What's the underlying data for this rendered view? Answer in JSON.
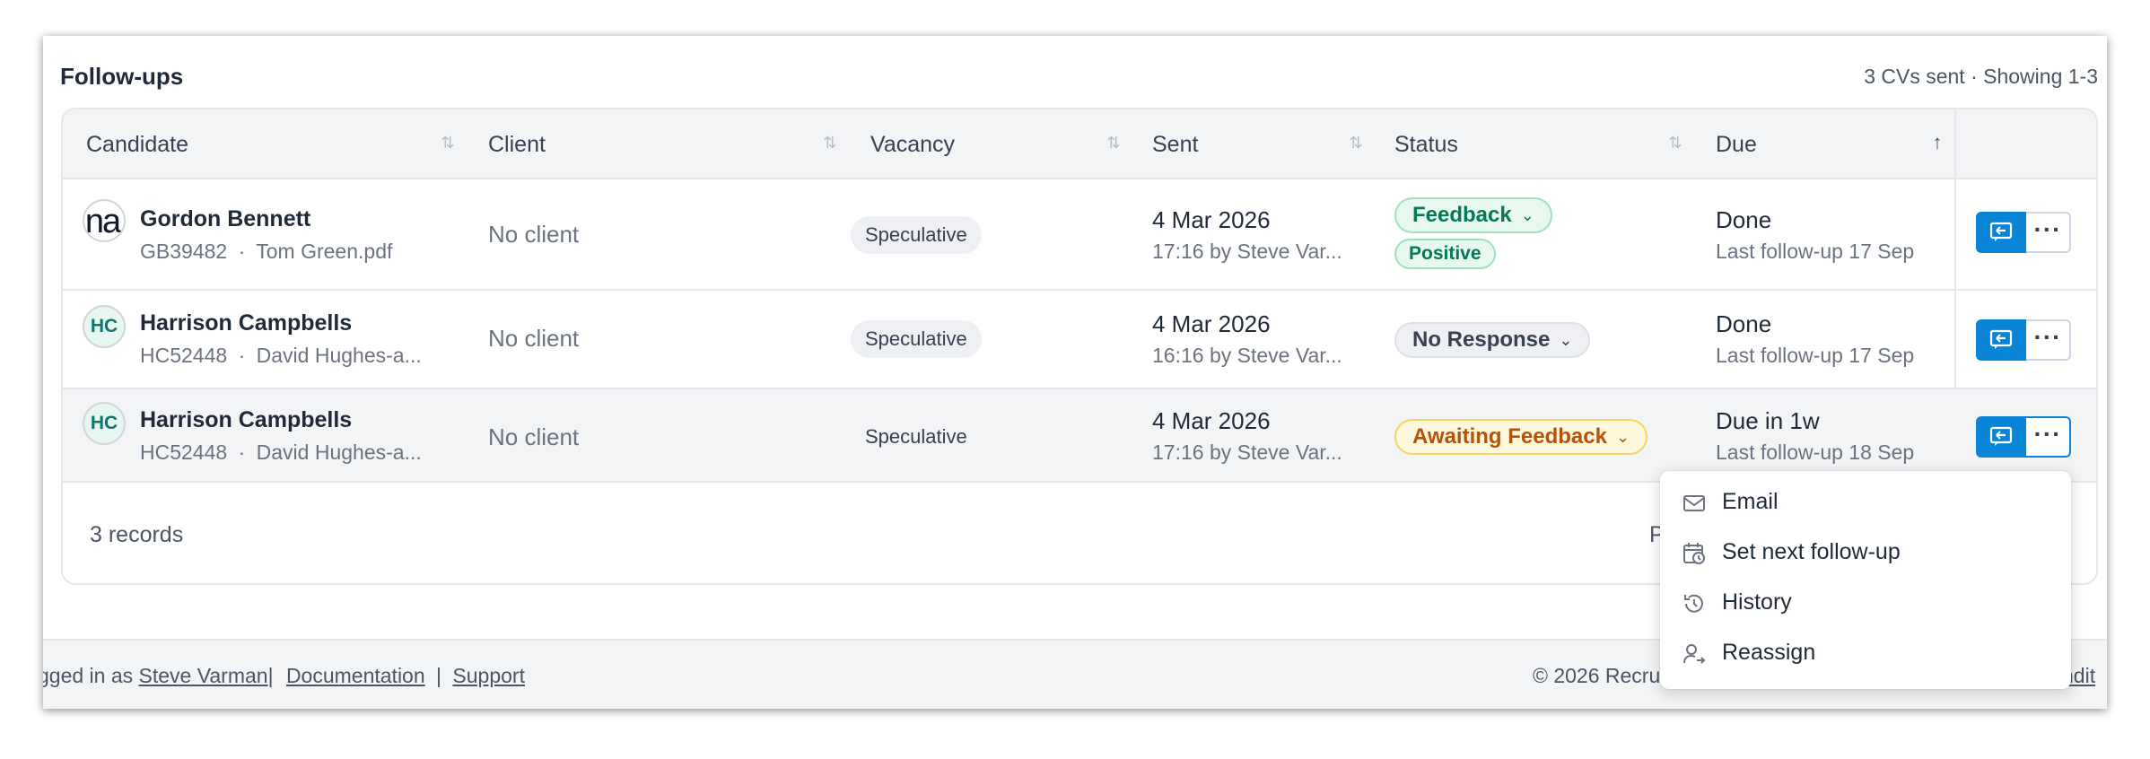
{
  "panel": {
    "title": "Follow-ups",
    "meta": "3 CVs sent · Showing 1-3"
  },
  "columns": {
    "candidate": "Candidate",
    "client": "Client",
    "vacancy": "Vacancy",
    "sent": "Sent",
    "status": "Status",
    "due": "Due"
  },
  "rows": [
    {
      "avatar": "na",
      "name": "Gordon Bennett",
      "ref": "GB39482",
      "doc": "Tom Green.pdf",
      "client": "No client",
      "vacancy": "Speculative",
      "sent_date": "4 Mar 2026",
      "sent_by": "17:16 by Steve Var...",
      "status": "Feedback",
      "status_sub": "Positive",
      "due": "Done",
      "due_sub": "Last follow-up 17 Sep"
    },
    {
      "avatar": "HC",
      "name": "Harrison Campbells",
      "ref": "HC52448",
      "doc": "David Hughes-a...",
      "client": "No client",
      "vacancy": "Speculative",
      "sent_date": "4 Mar 2026",
      "sent_by": "16:16 by Steve Var...",
      "status": "No Response",
      "due": "Done",
      "due_sub": "Last follow-up 17 Sep"
    },
    {
      "avatar": "HC",
      "name": "Harrison Campbells",
      "ref": "HC52448",
      "doc": "David Hughes-a...",
      "client": "No client",
      "vacancy": "Speculative",
      "sent_date": "4 Mar 2026",
      "sent_by": "17:16 by Steve Var...",
      "status": "Awaiting Feedback",
      "due": "Due in 1w",
      "due_sub": "Last follow-up 18 Sep"
    }
  ],
  "separator": "·",
  "more_glyph": "···",
  "records": "3 records",
  "pager_partial": "P",
  "footer": {
    "logged_prefix": "gged in as",
    "user": "Steve Varman",
    "sep": "|",
    "documentation": "Documentation",
    "support": "Support",
    "copyright": "© 2026 Recru",
    "right_link": "ndit"
  },
  "menu": {
    "items": [
      {
        "label": "Email",
        "icon": "mail-icon"
      },
      {
        "label": "Set next follow-up",
        "icon": "calendar-clock-icon"
      },
      {
        "label": "History",
        "icon": "history-icon"
      },
      {
        "label": "Reassign",
        "icon": "user-reassign-icon"
      }
    ]
  },
  "colors": {
    "primary": "#0a84d6",
    "success": "#047857",
    "warning": "#b45309"
  }
}
